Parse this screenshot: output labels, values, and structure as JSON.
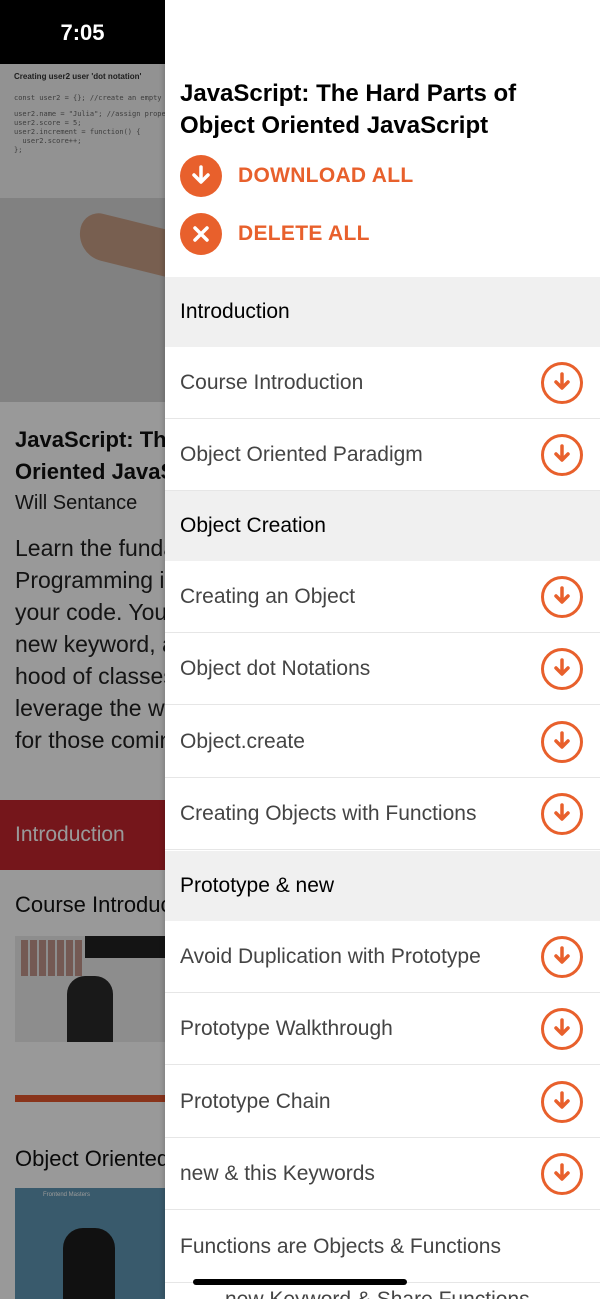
{
  "status_bar": {
    "time": "7:05"
  },
  "background": {
    "slide_title": "Creating user2 user 'dot notation'",
    "code_lines": [
      "const user2 = {}; //create an empty object",
      "user2.name = \"Julia\"; //assign properties",
      "user2.score = 5;",
      "user2.increment = function() {",
      "  user2.score++;",
      "};"
    ],
    "course_title": "JavaScript: The Hard Parts of Object Oriented JavaScript",
    "author": "Will Sentance",
    "description": "Learn the fundamentals of Object Oriented Programming in JavaScript for organizing and scaling your code. You will learn about prototypal design, the new keyword, and the new ES6 classes. Under the hood of classes and prototypes and learn how to leverage the working with objects. Especially helpful for those coming",
    "section_label": "Introduction",
    "lesson1_title": "Course Introduction",
    "lesson2_title": "Object Oriented Paradigm",
    "thumb2_label": "Frontend Masters"
  },
  "drawer": {
    "title": "JavaScript: The Hard Parts of Object Oriented JavaScript",
    "download_all": "DOWNLOAD ALL",
    "delete_all": "DELETE ALL",
    "accent_color": "#e8602c",
    "sections": [
      {
        "title": "Introduction",
        "lessons": [
          "Course Introduction",
          "Object Oriented Paradigm"
        ]
      },
      {
        "title": "Object Creation",
        "lessons": [
          "Creating an Object",
          "Object dot Notations",
          "Object.create",
          "Creating Objects with Functions"
        ]
      },
      {
        "title": "Prototype & new",
        "lessons": [
          "Avoid Duplication with Prototype",
          "Prototype Walkthrough",
          "Prototype Chain",
          "new & this Keywords",
          "Functions are Objects & Functions"
        ]
      }
    ],
    "partial_next": "new Keyword & Share Functions"
  }
}
